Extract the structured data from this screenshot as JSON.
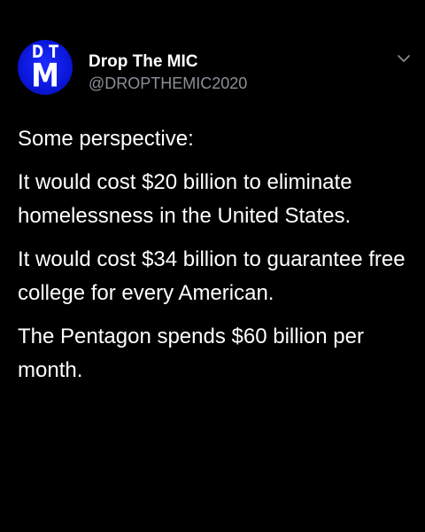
{
  "tweet": {
    "avatar": {
      "top_letters": "DT",
      "bottom_letter": "M",
      "color": "#0a16d8"
    },
    "display_name": "Drop The MIC",
    "handle": "@DROPTHEMIC2020",
    "menu_icon": "chevron-down-icon",
    "paragraphs": [
      "Some perspective:",
      "It would cost $20 billion to eliminate homelessness in the United States.",
      "It would cost $34 billion to guarantee free college for every American.",
      "The Pentagon spends $60 billion per month."
    ]
  }
}
